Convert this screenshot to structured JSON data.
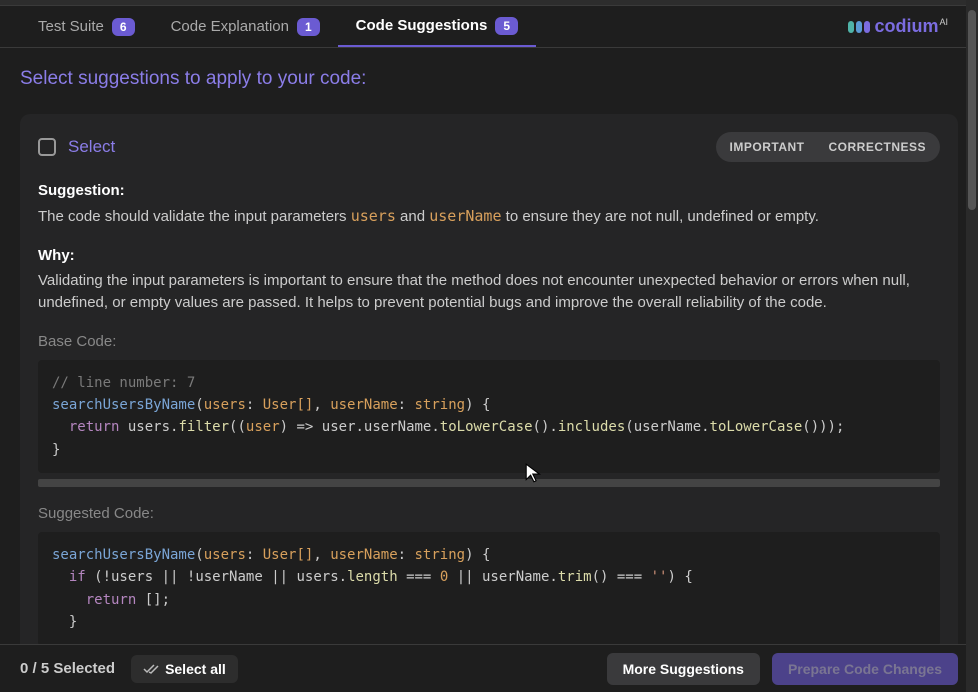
{
  "tabs": [
    {
      "label": "Test Suite",
      "count": "6"
    },
    {
      "label": "Code Explanation",
      "count": "1"
    },
    {
      "label": "Code Suggestions",
      "count": "5"
    }
  ],
  "logo": {
    "text": "codium",
    "suffix": "AI"
  },
  "heading": "Select suggestions to apply to your code:",
  "card": {
    "select_label": "Select",
    "tags": [
      "IMPORTANT",
      "CORRECTNESS"
    ],
    "suggestion_label": "Suggestion:",
    "suggestion_pre": "The code should validate the input parameters ",
    "suggestion_kw1": "users",
    "suggestion_mid": " and ",
    "suggestion_kw2": "userName",
    "suggestion_post": " to ensure they are not null, undefined or empty.",
    "why_label": "Why:",
    "why_text": "Validating the input parameters is important to ensure that the method does not encounter unexpected behavior or errors when null, undefined, or empty values are passed. It helps to prevent potential bugs and improve the overall reliability of the code.",
    "base_code_label": "Base Code:",
    "suggested_code_label": "Suggested Code:",
    "base_code": {
      "line1_comment": "// line number: 7",
      "method": "searchUsersByName",
      "p1": "users",
      "t1": "User[]",
      "p2": "userName",
      "t2": "string",
      "return_kw": "return",
      "obj1": "users",
      "filter": "filter",
      "arrow_param": "user",
      "arrow_body": "user.userName.",
      "toLower": "toLowerCase",
      "includes": "includes",
      "arg2": "userName.",
      "toLower2": "toLowerCase"
    },
    "suggested_code": {
      "method": "searchUsersByName",
      "p1": "users",
      "t1": "User[]",
      "p2": "userName",
      "t2": "string",
      "if_kw": "if",
      "cond1": "!users",
      "or": "||",
      "cond2": "!userName",
      "cond3a": "users.",
      "cond3b": "length",
      "eq": "===",
      "zero": "0",
      "cond4a": "userName.",
      "cond4b": "trim",
      "empty": "''",
      "return_kw": "return",
      "empty_arr": "[]"
    }
  },
  "footer": {
    "selected": "0 / 5 Selected",
    "select_all": "Select all",
    "more": "More Suggestions",
    "prepare": "Prepare Code Changes"
  }
}
